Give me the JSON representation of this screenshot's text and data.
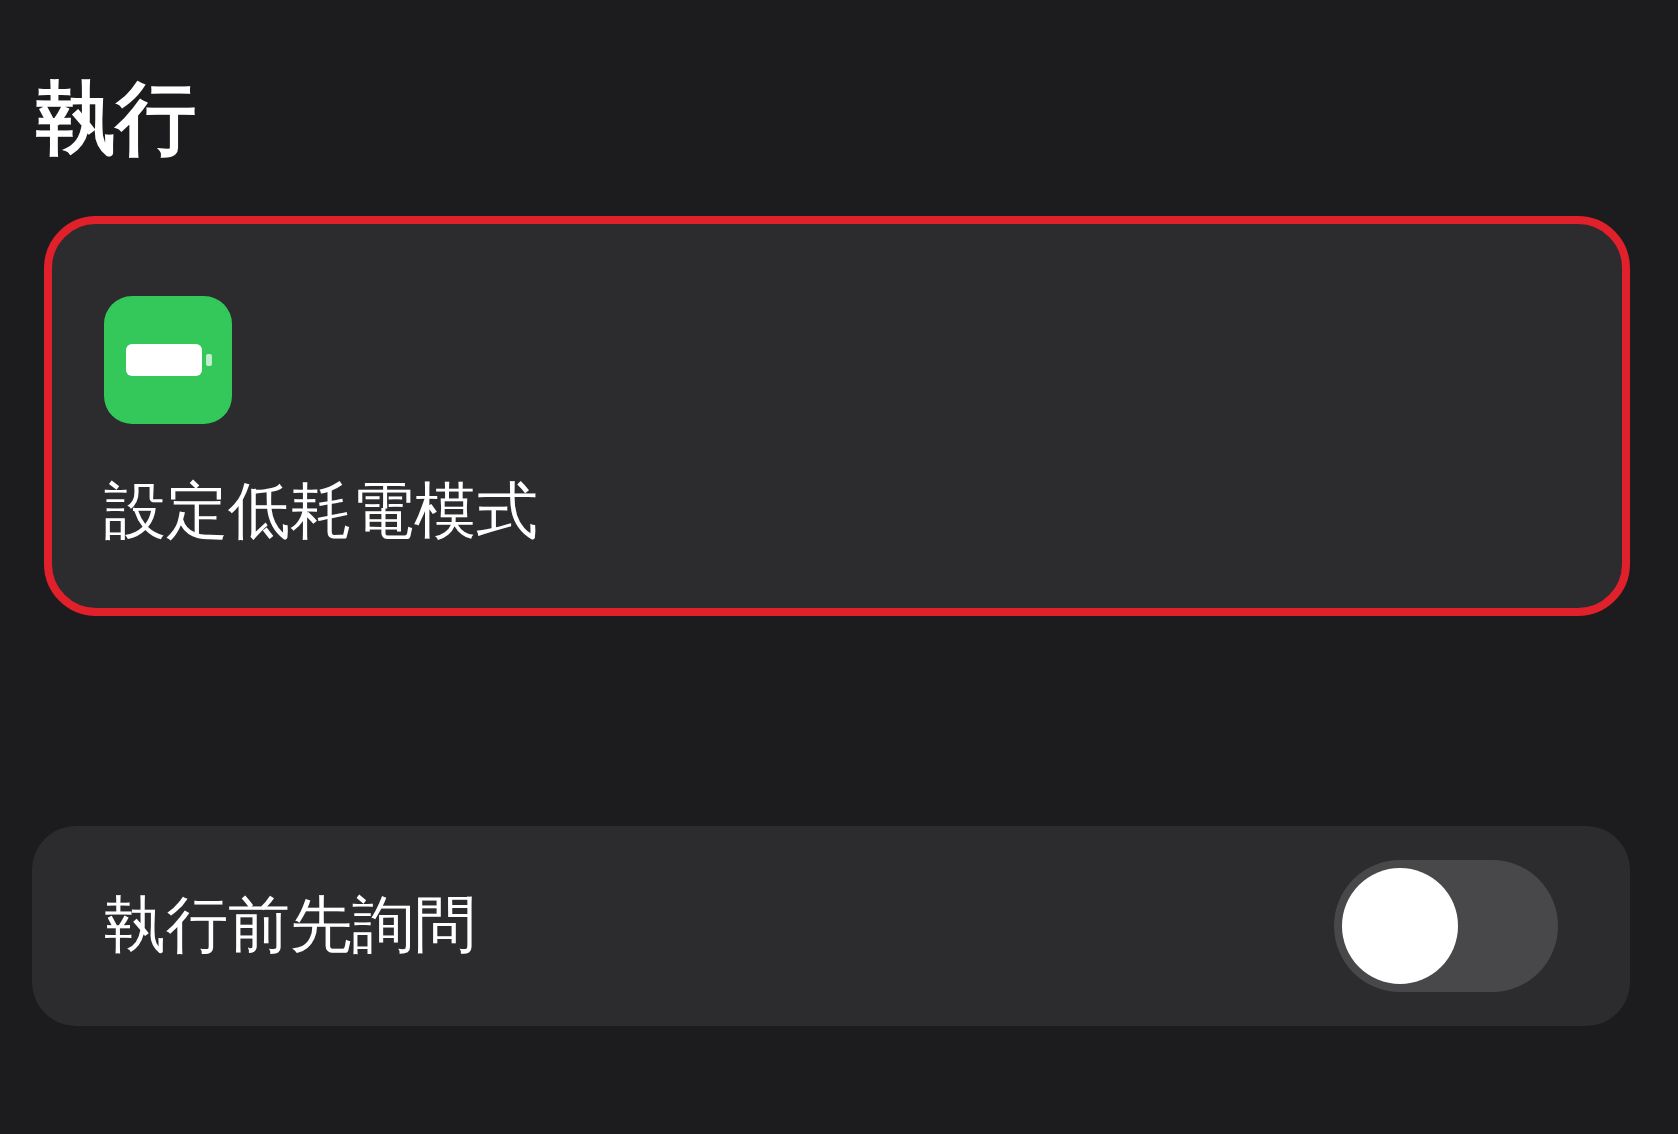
{
  "section_title": "執行",
  "action_card": {
    "label": "設定低耗電模式",
    "highlighted": true
  },
  "setting_row": {
    "label": "執行前先詢問",
    "on": false
  }
}
